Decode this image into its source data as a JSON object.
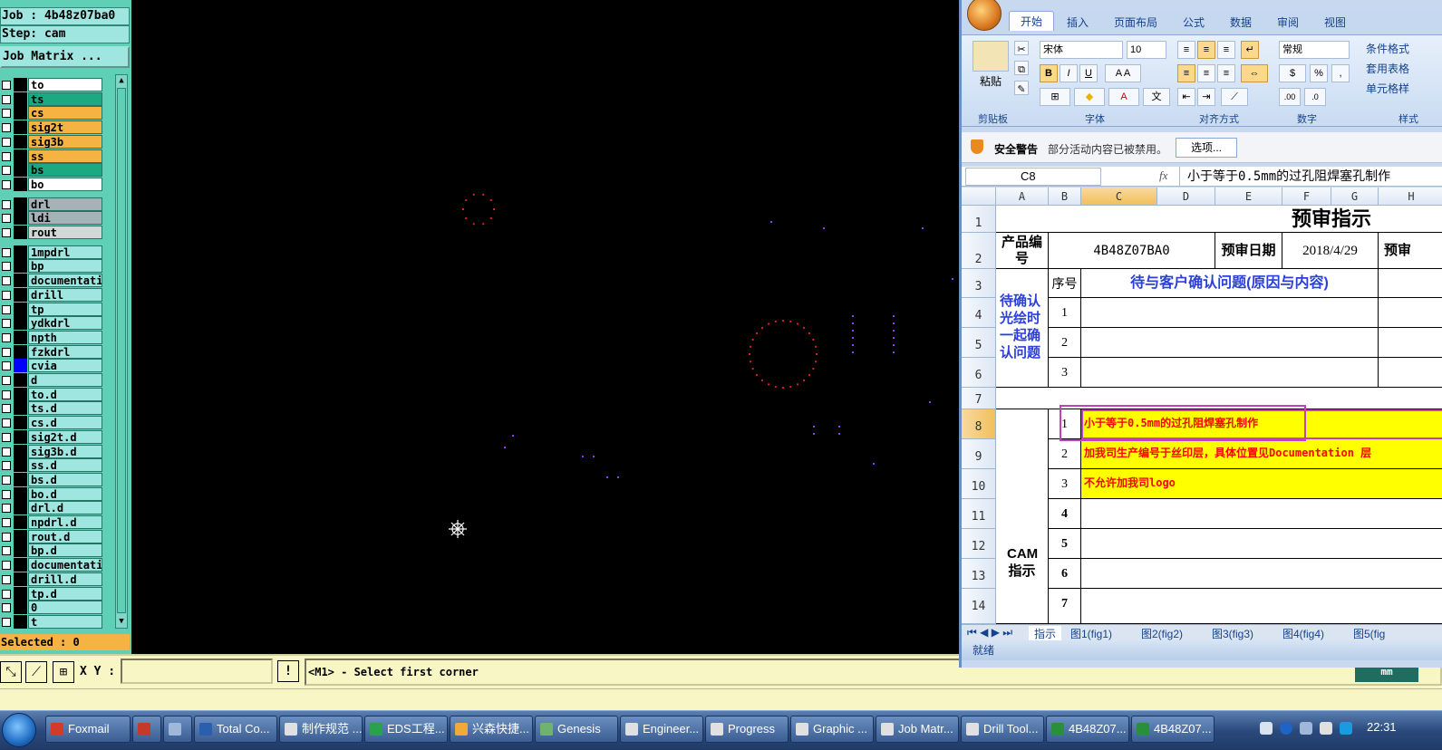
{
  "genesis": {
    "job_label": "Job : 4b48z07ba0",
    "step_label": "Step: cam",
    "job_matrix_button": "Job Matrix ...",
    "selected_label": "Selected : 0",
    "layers": [
      {
        "name": "to",
        "color": "#ffffff"
      },
      {
        "name": "ts",
        "color": "#1aa980"
      },
      {
        "name": "cs",
        "color": "#f4b342"
      },
      {
        "name": "sig2t",
        "color": "#f4b342"
      },
      {
        "name": "sig3b",
        "color": "#f4b342"
      },
      {
        "name": "ss",
        "color": "#f4b342"
      },
      {
        "name": "bs",
        "color": "#1aa980"
      },
      {
        "name": "bo",
        "color": "#ffffff"
      },
      {
        "name": "drl",
        "color": "#a6b2b8"
      },
      {
        "name": "ldi",
        "color": "#a6b2b8"
      },
      {
        "name": "rout",
        "color": "#d6d6d6"
      },
      {
        "name": "1mpdrl",
        "color": "#9ee6df"
      },
      {
        "name": "bp",
        "color": "#9ee6df"
      },
      {
        "name": "documentatio",
        "color": "#9ee6df"
      },
      {
        "name": "drill",
        "color": "#9ee6df"
      },
      {
        "name": "tp",
        "color": "#9ee6df"
      },
      {
        "name": "ydkdrl",
        "color": "#9ee6df"
      },
      {
        "name": "npth",
        "color": "#9ee6df"
      },
      {
        "name": "fzkdrl",
        "color": "#9ee6df"
      },
      {
        "name": "cvia",
        "color": "#9ee6df",
        "marker": "#0000ff"
      },
      {
        "name": "d",
        "color": "#9ee6df"
      },
      {
        "name": "to.d",
        "color": "#9ee6df"
      },
      {
        "name": "ts.d",
        "color": "#9ee6df"
      },
      {
        "name": "cs.d",
        "color": "#9ee6df"
      },
      {
        "name": "sig2t.d",
        "color": "#9ee6df"
      },
      {
        "name": "sig3b.d",
        "color": "#9ee6df"
      },
      {
        "name": "ss.d",
        "color": "#9ee6df"
      },
      {
        "name": "bs.d",
        "color": "#9ee6df"
      },
      {
        "name": "bo.d",
        "color": "#9ee6df"
      },
      {
        "name": "drl.d",
        "color": "#9ee6df"
      },
      {
        "name": "npdrl.d",
        "color": "#9ee6df"
      },
      {
        "name": "rout.d",
        "color": "#9ee6df"
      },
      {
        "name": "bp.d",
        "color": "#9ee6df"
      },
      {
        "name": "documentatio",
        "color": "#9ee6df"
      },
      {
        "name": "drill.d",
        "color": "#9ee6df"
      },
      {
        "name": "tp.d",
        "color": "#9ee6df"
      },
      {
        "name": "0",
        "color": "#9ee6df"
      },
      {
        "name": "t",
        "color": "#9ee6df"
      }
    ],
    "xy_label": "X Y :",
    "xy_value": "",
    "excl_label": "!",
    "prompt": "<M1> - Select first corner",
    "unit_button": "mm"
  },
  "excel": {
    "tabs": [
      "开始",
      "插入",
      "页面布局",
      "公式",
      "数据",
      "审阅",
      "视图"
    ],
    "groups": [
      "剪贴板",
      "字体",
      "对齐方式",
      "数字",
      "样式"
    ],
    "paste_label": "粘贴",
    "font_name": "宋体",
    "font_size": "10",
    "number_format": "常规",
    "style_items": [
      "条件格式",
      "套用表格",
      "单元格样"
    ],
    "security_title": "安全警告",
    "security_msg": "部分活动内容已被禁用。",
    "options_button": "选项...",
    "name_box": "C8",
    "fx": "fx",
    "formula": "小于等于0.5mm的过孔阻焊塞孔制作",
    "columns": [
      "A",
      "B",
      "C",
      "D",
      "E",
      "F",
      "G",
      "H"
    ],
    "rows": [
      "1",
      "2",
      "3",
      "4",
      "5",
      "6",
      "7",
      "8",
      "9",
      "10",
      "11",
      "12",
      "13",
      "14"
    ],
    "title": "预审指示",
    "product_no_label": "产品编号",
    "product_no": "4B48Z07BA0",
    "review_date_label": "预审日期",
    "review_date": "2018/4/29",
    "review_label_trunc": "预审",
    "seq_header": "序号",
    "issues_header": "待与客户确认问题(原因与内容)",
    "pending_label": "待确认光绘时一起确认问题",
    "pending_nums": [
      "1",
      "2",
      "3"
    ],
    "cam_label": "CAM指示",
    "cam_nums": [
      "1",
      "2",
      "3",
      "4",
      "5",
      "6",
      "7"
    ],
    "cam_items": [
      "小于等于0.5mm的过孔阻焊塞孔制作",
      "加我司生产编号于丝印层，具体位置见Documentation 层",
      "不允许加我司logo",
      "",
      "",
      "",
      ""
    ],
    "sheet_tabs": [
      "指示",
      "图1(fig1)",
      "图2(fig2)",
      "图3(fig3)",
      "图4(fig4)",
      "图5(fig"
    ],
    "status": "就绪"
  },
  "taskbar": {
    "items": [
      {
        "label": "Foxmail",
        "color": "#d43a2a"
      },
      {
        "label": "",
        "color": "#c43a2a"
      },
      {
        "label": "",
        "color": "#9fb7d9"
      },
      {
        "label": "Total Co...",
        "color": "#2a5fb0"
      },
      {
        "label": "制作规范 ...",
        "color": "#e0e0e0"
      },
      {
        "label": "EDS工程...",
        "color": "#2aa14a"
      },
      {
        "label": "兴森快捷...",
        "color": "#f1a93a"
      },
      {
        "label": "Genesis",
        "color": "#6fb36f"
      },
      {
        "label": "Engineer...",
        "color": "#e0e0e0"
      },
      {
        "label": "Progress",
        "color": "#e0e0e0"
      },
      {
        "label": "Graphic ...",
        "color": "#e0e0e0"
      },
      {
        "label": "Job Matr...",
        "color": "#e0e0e0"
      },
      {
        "label": "Drill Tool...",
        "color": "#e0e0e0"
      },
      {
        "label": "4B48Z07...",
        "color": "#2a8f3a"
      },
      {
        "label": "4B48Z07...",
        "color": "#2a8f3a"
      }
    ],
    "clock": "22:31"
  }
}
